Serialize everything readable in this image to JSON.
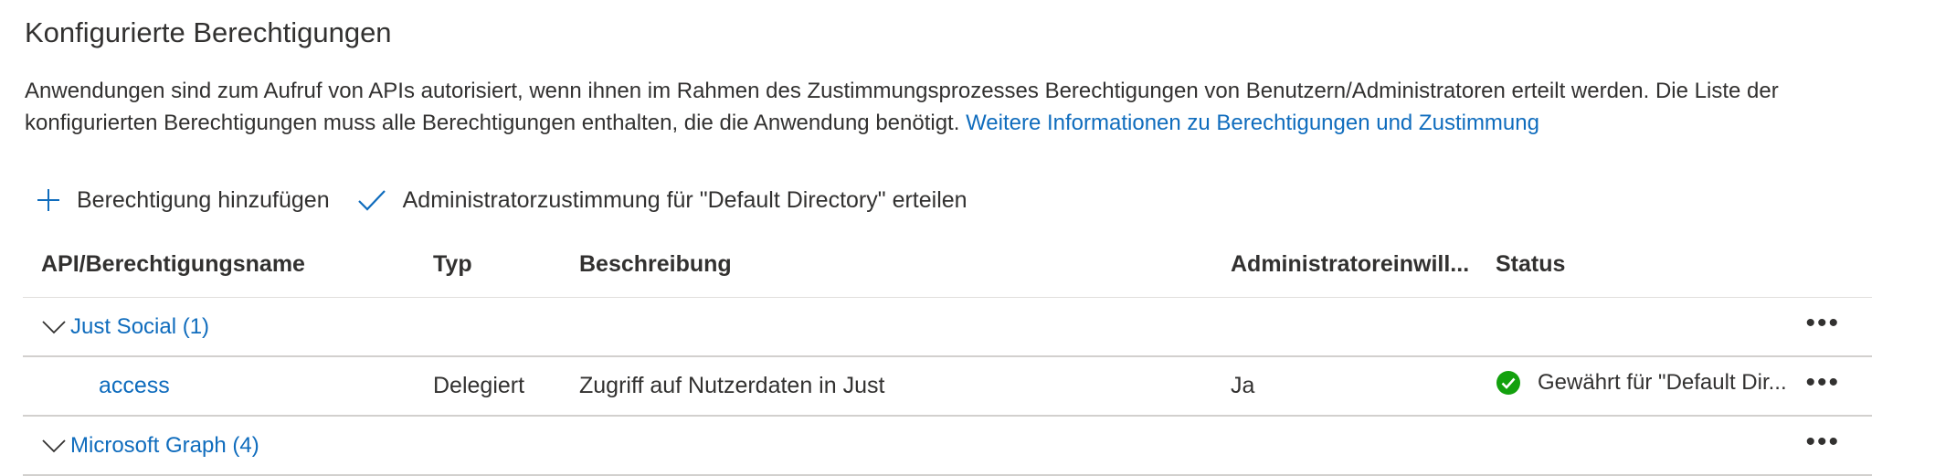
{
  "title": "Konfigurierte Berechtigungen",
  "description": {
    "text": "Anwendungen sind zum Aufruf von APIs autorisiert, wenn ihnen im Rahmen des Zustimmungsprozesses Berechtigungen von Benutzern/Administratoren erteilt werden. Die Liste der konfigurierten Berechtigungen muss alle Berechtigungen enthalten, die die Anwendung benötigt.",
    "link": "Weitere Informationen zu Berechtigungen und Zustimmung"
  },
  "toolbar": {
    "add_label": "Berechtigung hinzufügen",
    "grant_label": "Administratorzustimmung für \"Default Directory\" erteilen"
  },
  "table": {
    "headers": {
      "name": "API/Berechtigungsname",
      "type": "Typ",
      "description": "Beschreibung",
      "admin_consent": "Administratoreinwill...",
      "status": "Status"
    },
    "groups": [
      {
        "label": "Just Social (1)",
        "permissions": [
          {
            "name": "access",
            "type": "Delegiert",
            "description": "Zugriff auf Nutzerdaten in Just",
            "admin_consent": "Ja",
            "status": "Gewährt für \"Default Dir..."
          }
        ]
      },
      {
        "label": "Microsoft Graph (4)",
        "permissions": []
      }
    ]
  },
  "colors": {
    "accent": "#0f6cbd",
    "success": "#13a10e",
    "text": "#323130",
    "border": "#d2d0ce"
  },
  "icons": {
    "add": "plus-icon",
    "grant": "checkmark-icon",
    "expand": "chevron-down-icon",
    "more": "more-icon",
    "status": "success-check-icon"
  }
}
